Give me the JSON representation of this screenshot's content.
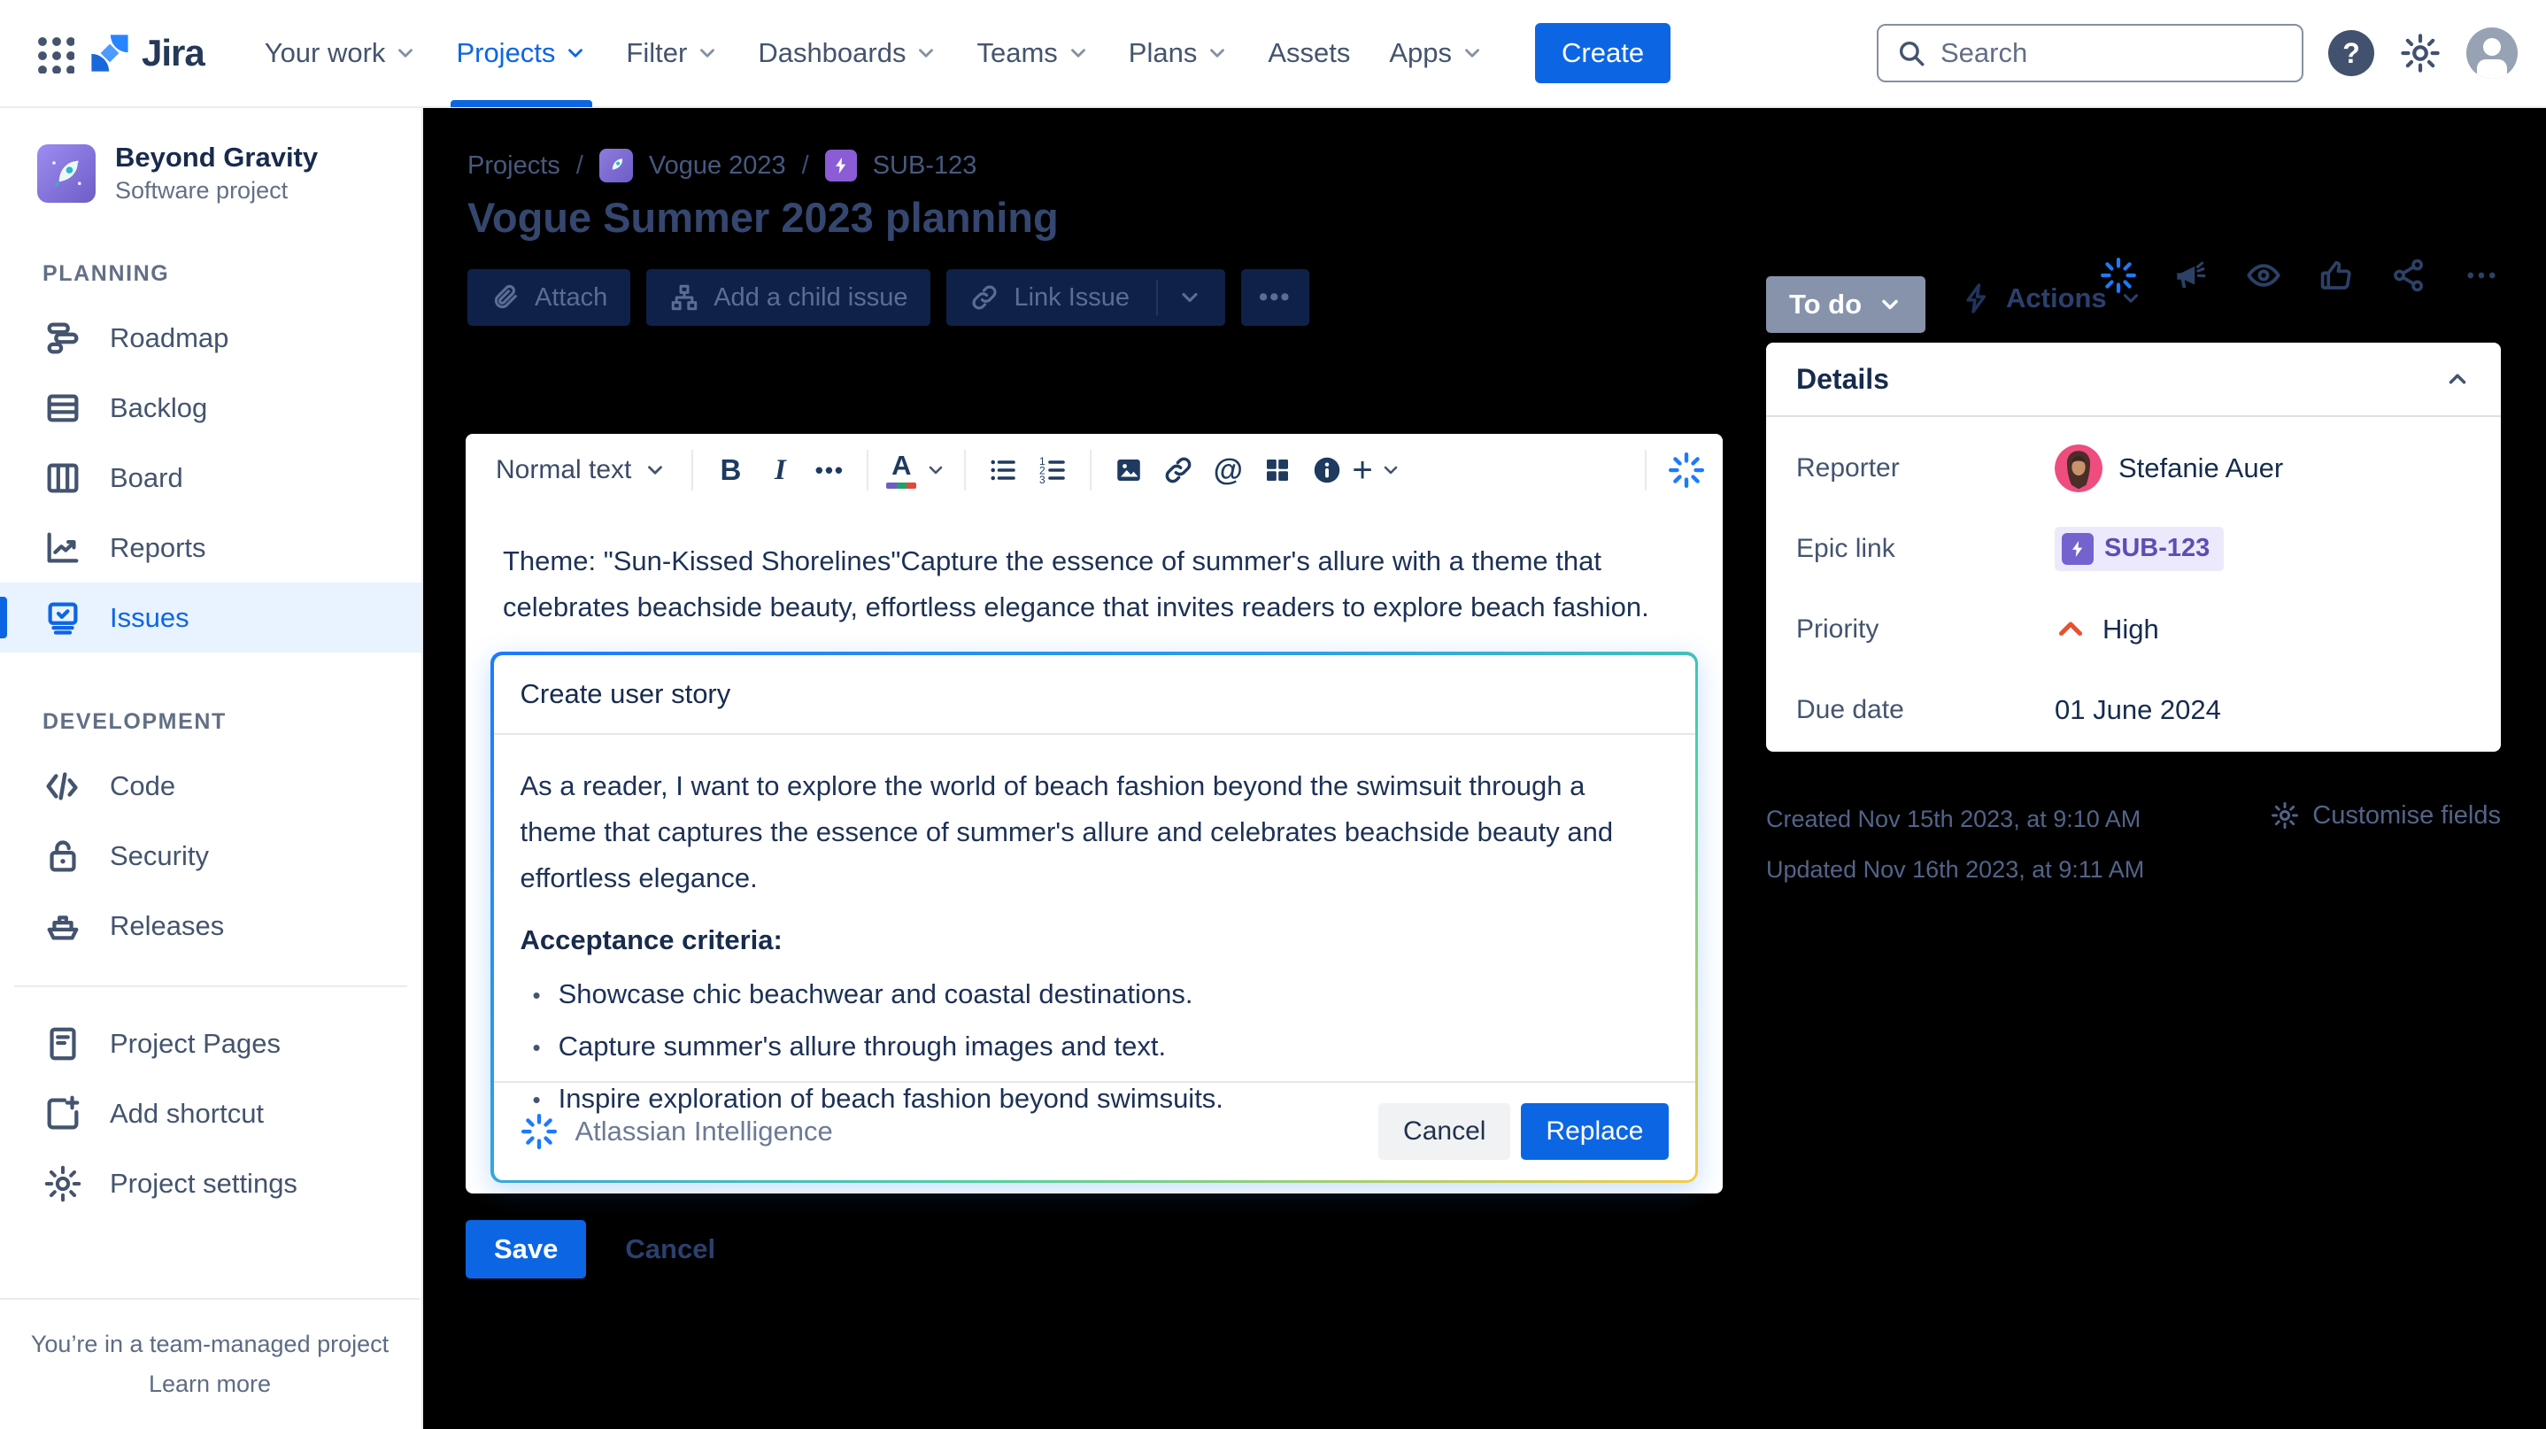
{
  "nav": {
    "logo": "Jira",
    "items": [
      {
        "label": "Your work"
      },
      {
        "label": "Projects"
      },
      {
        "label": "Filter"
      },
      {
        "label": "Dashboards"
      },
      {
        "label": "Teams"
      },
      {
        "label": "Plans"
      },
      {
        "label": "Assets"
      },
      {
        "label": "Apps"
      }
    ],
    "create_label": "Create",
    "search_placeholder": "Search"
  },
  "sidebar": {
    "project": {
      "name": "Beyond Gravity",
      "type": "Software project"
    },
    "sections": [
      {
        "title": "PLANNING",
        "items": [
          {
            "label": "Roadmap"
          },
          {
            "label": "Backlog"
          },
          {
            "label": "Board"
          },
          {
            "label": "Reports"
          },
          {
            "label": "Issues"
          }
        ]
      },
      {
        "title": "DEVELOPMENT",
        "items": [
          {
            "label": "Code"
          },
          {
            "label": "Security"
          },
          {
            "label": "Releases"
          }
        ]
      }
    ],
    "shortcuts": [
      {
        "label": "Project Pages"
      },
      {
        "label": "Add shortcut"
      },
      {
        "label": "Project settings"
      }
    ],
    "footer": {
      "line1": "You’re in a team-managed project",
      "line2": "Learn more"
    }
  },
  "content": {
    "breadcrumb": {
      "projects": "Projects",
      "project": "Vogue 2023",
      "issue": "SUB-123"
    },
    "title": "Vogue Summer 2023 planning",
    "actions_bar": {
      "attach": "Attach",
      "add_child": "Add a child issue",
      "link_issue": "Link Issue"
    },
    "status": {
      "label": "To do"
    },
    "actions_menu": "Actions",
    "editor": {
      "toolbar": {
        "style": "Normal text"
      },
      "paragraph": "Theme:  \"Sun-Kissed Shorelines\"Capture the essence of summer's allure with a theme that celebrates beachside beauty, effortless elegance that invites readers to explore  beach fashion."
    },
    "ai_panel": {
      "prompt": "Create user story",
      "story": "As a reader, I want to explore the world of beach fashion beyond the swimsuit through a theme that captures the essence of summer's allure and celebrates beachside beauty and effortless elegance.",
      "criteria_heading": "Acceptance criteria:",
      "criteria": [
        "Showcase chic beachwear and coastal destinations.",
        "Capture summer's allure through images and text.",
        "Inspire exploration of beach fashion beyond swimsuits."
      ],
      "brand": "Atlassian Intelligence",
      "cancel_label": "Cancel",
      "replace_label": "Replace"
    },
    "save_label": "Save",
    "cancel_label": "Cancel"
  },
  "details": {
    "title": "Details",
    "reporter_label": "Reporter",
    "reporter_value": "Stefanie Auer",
    "epic_label": "Epic link",
    "epic_value": "SUB-123",
    "priority_label": "Priority",
    "priority_value": "High",
    "due_label": "Due date",
    "due_value": "01 June 2024",
    "created": "Created Nov 15th 2023, at 9:10 AM",
    "updated": "Updated Nov 16th 2023, at 9:11 AM",
    "customise": "Customise fields"
  },
  "glyphs": {
    "slash": "/",
    "bold": "B",
    "italic": "I",
    "more": "•••",
    "color_letter": "A",
    "at": "@",
    "plus": "+",
    "help": "?",
    "bullet": "•",
    "ellipsis": "•••"
  },
  "colors": {
    "accent": "#0C66E4",
    "ai_blue": "#1D7AFC",
    "priority_high": "#E8502E",
    "epic_purple": "#6E5DC6",
    "overlay": "#000000",
    "active_bg": "#E9F2FF"
  }
}
